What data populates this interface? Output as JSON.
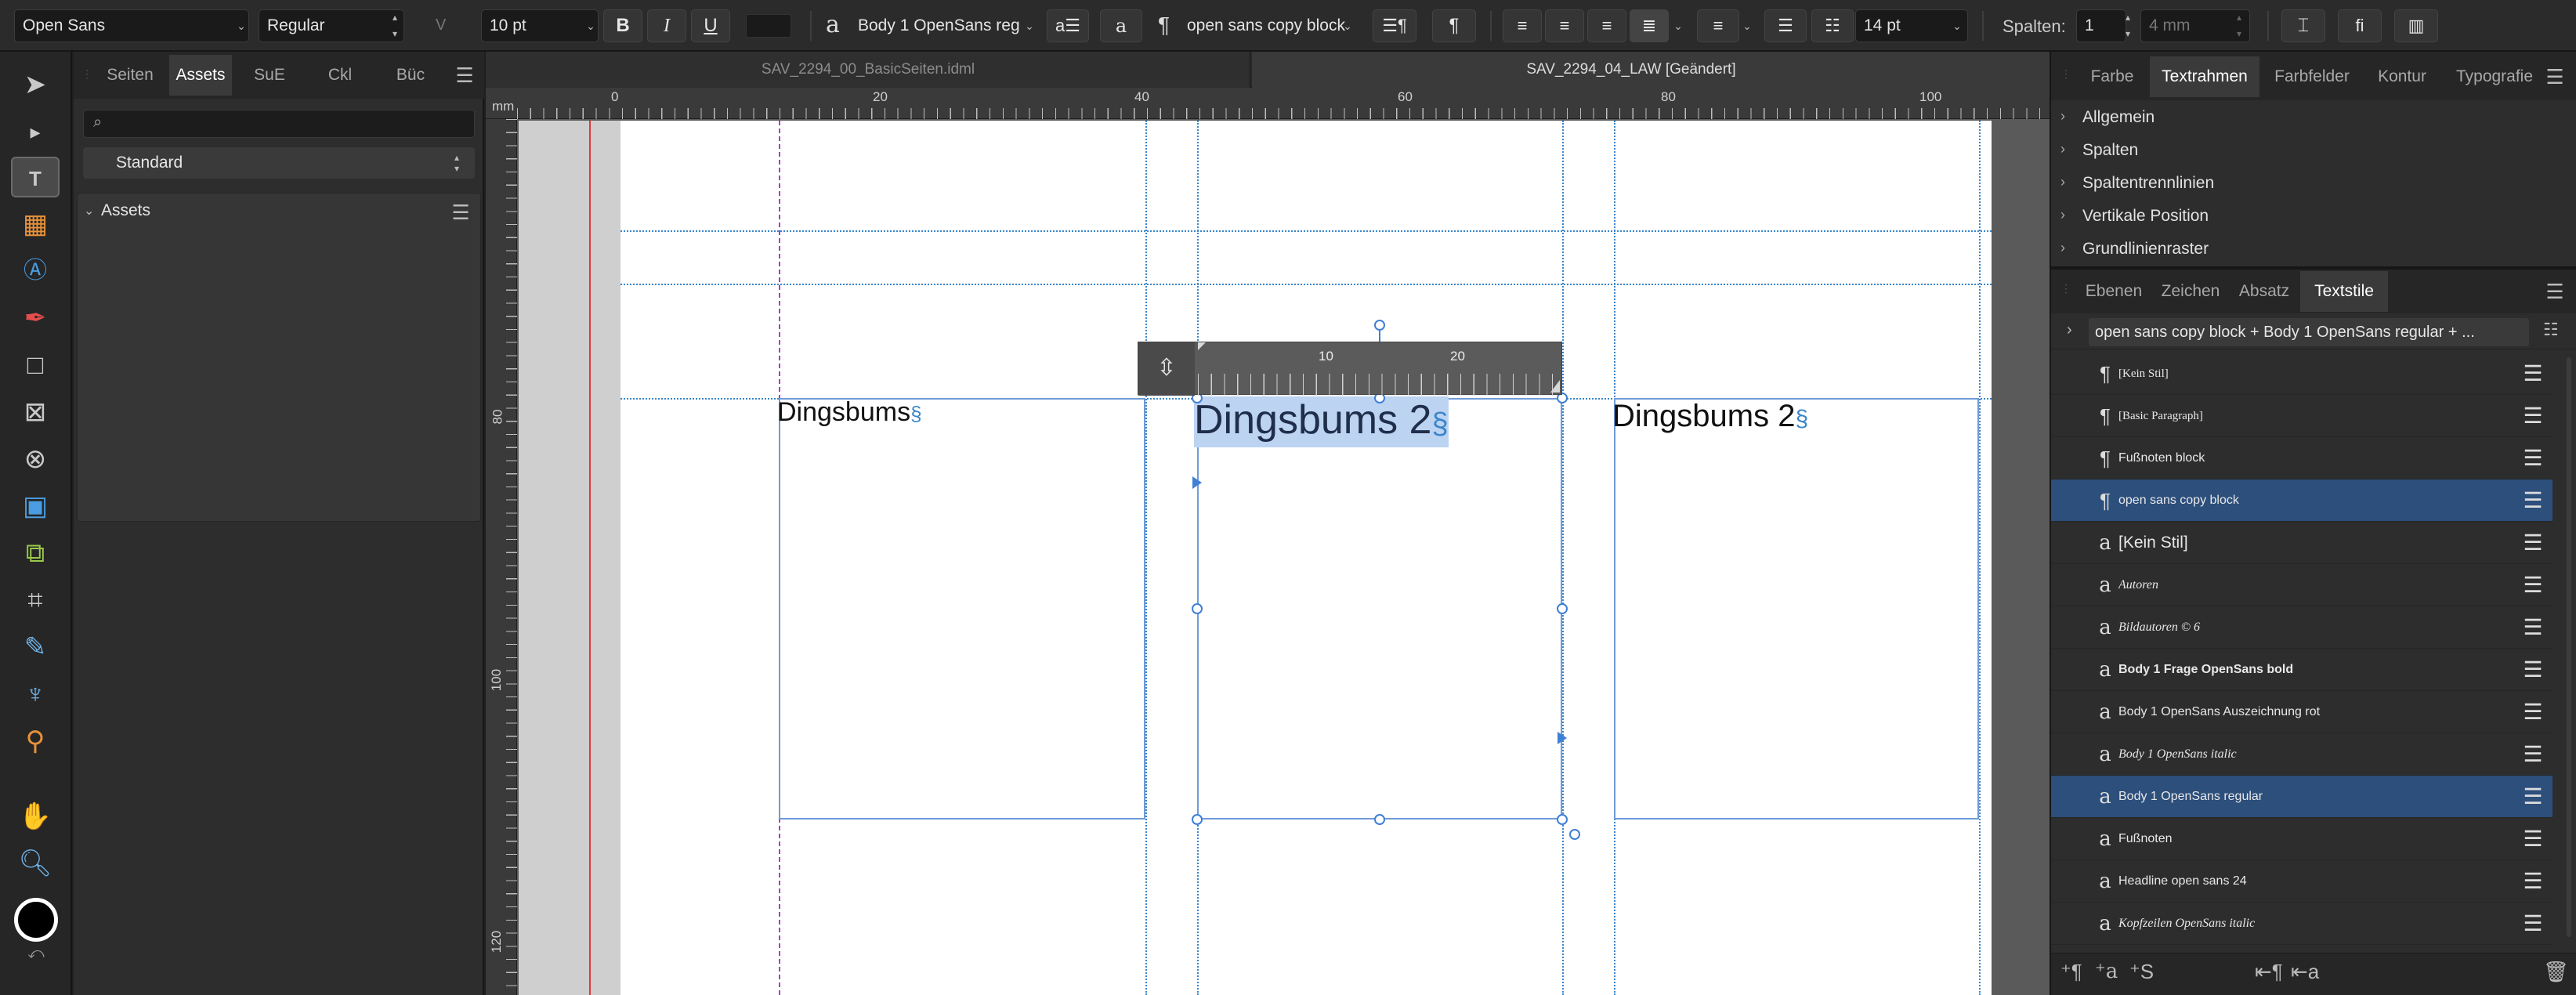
{
  "toolbar": {
    "font_family": "Open Sans",
    "font_style": "Regular",
    "kerning_label": "V",
    "font_size": "10 pt",
    "bold_label": "B",
    "italic_label": "I",
    "underline_label": "U",
    "char_style_glyph": "a",
    "char_style": "Body 1 OpenSans reg",
    "para_glyph": "¶",
    "para_style": "open sans copy block",
    "leading": "14 pt",
    "columns_label": "Spalten:",
    "columns_value": "1",
    "gutter_value": "4 mm"
  },
  "tools": [
    "move-tool",
    "node-tool",
    "frame-text-tool",
    "table-tool",
    "artistic-text-tool",
    "pen-tool",
    "rectangle-tool",
    "picture-frame-tool",
    "ellipse-frame-tool",
    "place-image-tool",
    "pinned-frame-tool",
    "crop-tool",
    "fill-tool",
    "transparency-tool",
    "color-picker-tool",
    "hand-tool",
    "zoom-tool"
  ],
  "left_panel": {
    "tabs": [
      "Seiten",
      "Assets",
      "SuE",
      "Ckl",
      "Büc"
    ],
    "active_tab": "Assets",
    "search_placeholder": "",
    "category": "Standard",
    "section_title": "Assets"
  },
  "document_tabs": [
    {
      "label": "SAV_2294_00_BasicSeiten.idml",
      "active": false
    },
    {
      "label": "SAV_2294_04_LAW [Geändert]",
      "active": true
    }
  ],
  "ruler": {
    "unit": "mm",
    "h_ticks": [
      "0",
      "20",
      "40",
      "60",
      "80",
      "100"
    ],
    "v_ticks": [
      "80",
      "100",
      "120"
    ],
    "inline_ticks": [
      "10",
      "20"
    ]
  },
  "canvas": {
    "frame1_text": "Dingsbums",
    "frame2_text": "Dingsbums 2",
    "frame3_text": "Dingsbums 2",
    "para_mark": "§"
  },
  "right_top": {
    "tabs": [
      "Farbe",
      "Textrahmen",
      "Farbfelder",
      "Kontur",
      "Typografie"
    ],
    "active_tab": "Textrahmen",
    "sections": [
      "Allgemein",
      "Spalten",
      "Spaltentrennlinien",
      "Vertikale Position",
      "Grundlinienraster"
    ]
  },
  "right_bottom": {
    "tabs": [
      "Ebenen",
      "Zeichen",
      "Absatz",
      "Textstile"
    ],
    "active_tab": "Textstile",
    "header": "open sans copy block + Body 1 OpenSans regular + ...",
    "styles": [
      {
        "kind": "paragraph",
        "name": "[Kein Stil]",
        "font": "serif-small",
        "selected": false
      },
      {
        "kind": "paragraph",
        "name": "[Basic Paragraph]",
        "font": "serif-small",
        "selected": false
      },
      {
        "kind": "paragraph",
        "name": "Fußnoten block",
        "font": "small",
        "selected": false
      },
      {
        "kind": "paragraph",
        "name": "open sans copy block",
        "font": "small",
        "selected": true
      },
      {
        "kind": "character",
        "name": "[Kein Stil]",
        "font": "normal",
        "selected": false
      },
      {
        "kind": "character",
        "name": "Autoren",
        "font": "italic",
        "selected": false
      },
      {
        "kind": "character",
        "name": "Bildautoren © 6",
        "font": "italic",
        "selected": false
      },
      {
        "kind": "character",
        "name": "Body 1 Frage OpenSans bold",
        "font": "bold",
        "selected": false
      },
      {
        "kind": "character",
        "name": "Body 1 OpenSans Auszeichnung rot",
        "font": "small",
        "selected": false
      },
      {
        "kind": "character",
        "name": "Body 1 OpenSans italic",
        "font": "italic",
        "selected": false
      },
      {
        "kind": "character",
        "name": "Body 1 OpenSans regular",
        "font": "small",
        "selected": true
      },
      {
        "kind": "character",
        "name": "Fußnoten",
        "font": "small",
        "selected": false
      },
      {
        "kind": "character",
        "name": "Headline open sans 24",
        "font": "small",
        "selected": false
      },
      {
        "kind": "character",
        "name": "Kopfzeilen OpenSans italic",
        "font": "italic",
        "selected": false
      }
    ]
  },
  "colors": {
    "accent_selection": "#2c4f7c",
    "text_frame": "#6f9bd8",
    "guide": "#3a85c9",
    "margin_guide": "#e03a3a",
    "bleed_guide": "#b03ac9"
  }
}
